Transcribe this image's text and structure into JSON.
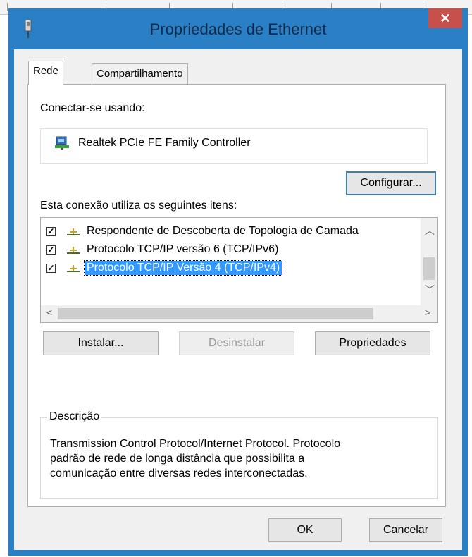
{
  "window": {
    "title": "Propriedades de Ethernet"
  },
  "tabs": [
    {
      "label": "Rede"
    },
    {
      "label": "Compartilhamento"
    }
  ],
  "connect": {
    "label": "Conectar-se usando:",
    "adapter": "Realtek PCIe FE Family Controller",
    "configure_button": "Configurar..."
  },
  "items": {
    "label": "Esta conexão utiliza os seguintes itens:",
    "list": [
      {
        "text": "Respondente de Descoberta de Topologia de Camada",
        "checked": true,
        "selected": false
      },
      {
        "text": "Protocolo TCP/IP versão 6 (TCP/IPv6)",
        "checked": true,
        "selected": false
      },
      {
        "text": "Protocolo TCP/IP Versão 4 (TCP/IPv4)",
        "checked": true,
        "selected": true
      }
    ]
  },
  "actions": {
    "install": "Instalar...",
    "uninstall": "Desinstalar",
    "properties": "Propriedades"
  },
  "description": {
    "legend": "Descrição",
    "lines": [
      "Transmission Control Protocol/Internet Protocol. Protocolo",
      "padrão de rede de longa distância que possibilita a",
      "comunicação entre diversas redes interconectadas."
    ]
  },
  "footer": {
    "ok": "OK",
    "cancel": "Cancelar"
  },
  "colors": {
    "titlebar": "#2b80c5",
    "close": "#c7504a",
    "selection": "#3399ff"
  }
}
